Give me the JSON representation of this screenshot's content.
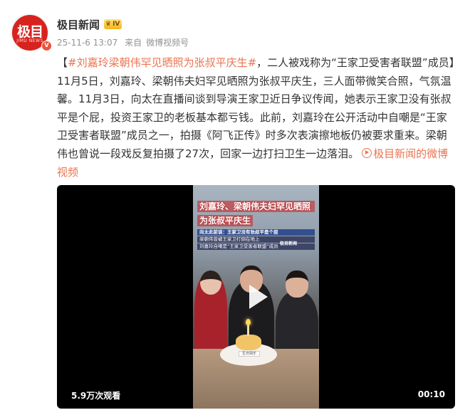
{
  "account": {
    "name": "极目新闻",
    "level_badge": "IV",
    "avatar_logo": "极目",
    "avatar_sub": "JIMU NEWS",
    "verified_mark": "V"
  },
  "meta": {
    "time": "25-11-6 13:07",
    "source_prefix": "来自",
    "source": "微博视频号"
  },
  "post": {
    "topic": "#刘嘉玲梁朝伟罕见晒照为张叔平庆生#",
    "body": "，二人被戏称为“王家卫受害者联盟”成员】11月5日，刘嘉玲、梁朝伟夫妇罕见晒照为张叔平庆生，三人面带微笑合照，气氛温馨。11月3日，向太在直播间谈到导演王家卫近日争议传闻，她表示王家卫没有张叔平是个屁，投资王家卫的老板基本都亏钱。此前，刘嘉玲在公开活动中自嘲是“王家卫受害者联盟”成员之一，拍摄《阿飞正传》时多次表演擦地板仍被要求重来。梁朝伟也曾说一段戏反复拍摄了27次，回家一边打扫卫生一边落泪。",
    "open_bracket": "【",
    "video_link": "极目新闻的微博视频"
  },
  "video": {
    "headline_1": "刘嘉玲、梁朝伟夫妇罕见晒照",
    "headline_2": "为张叔平庆生",
    "caption_1": "向太此前谈：王家卫没有张叔平是个屁",
    "caption_2": "梁朝伟曾被王家卫打倒在地上",
    "caption_3": "刘嘉玲自嘲是“王家卫受害者联盟”成员",
    "logo": "极目新闻",
    "cake_label": "生日快乐",
    "views": "5.9万次观看",
    "duration": "00:10"
  },
  "colors": {
    "link": "#eb7350",
    "brand_red": "#d7231e"
  }
}
